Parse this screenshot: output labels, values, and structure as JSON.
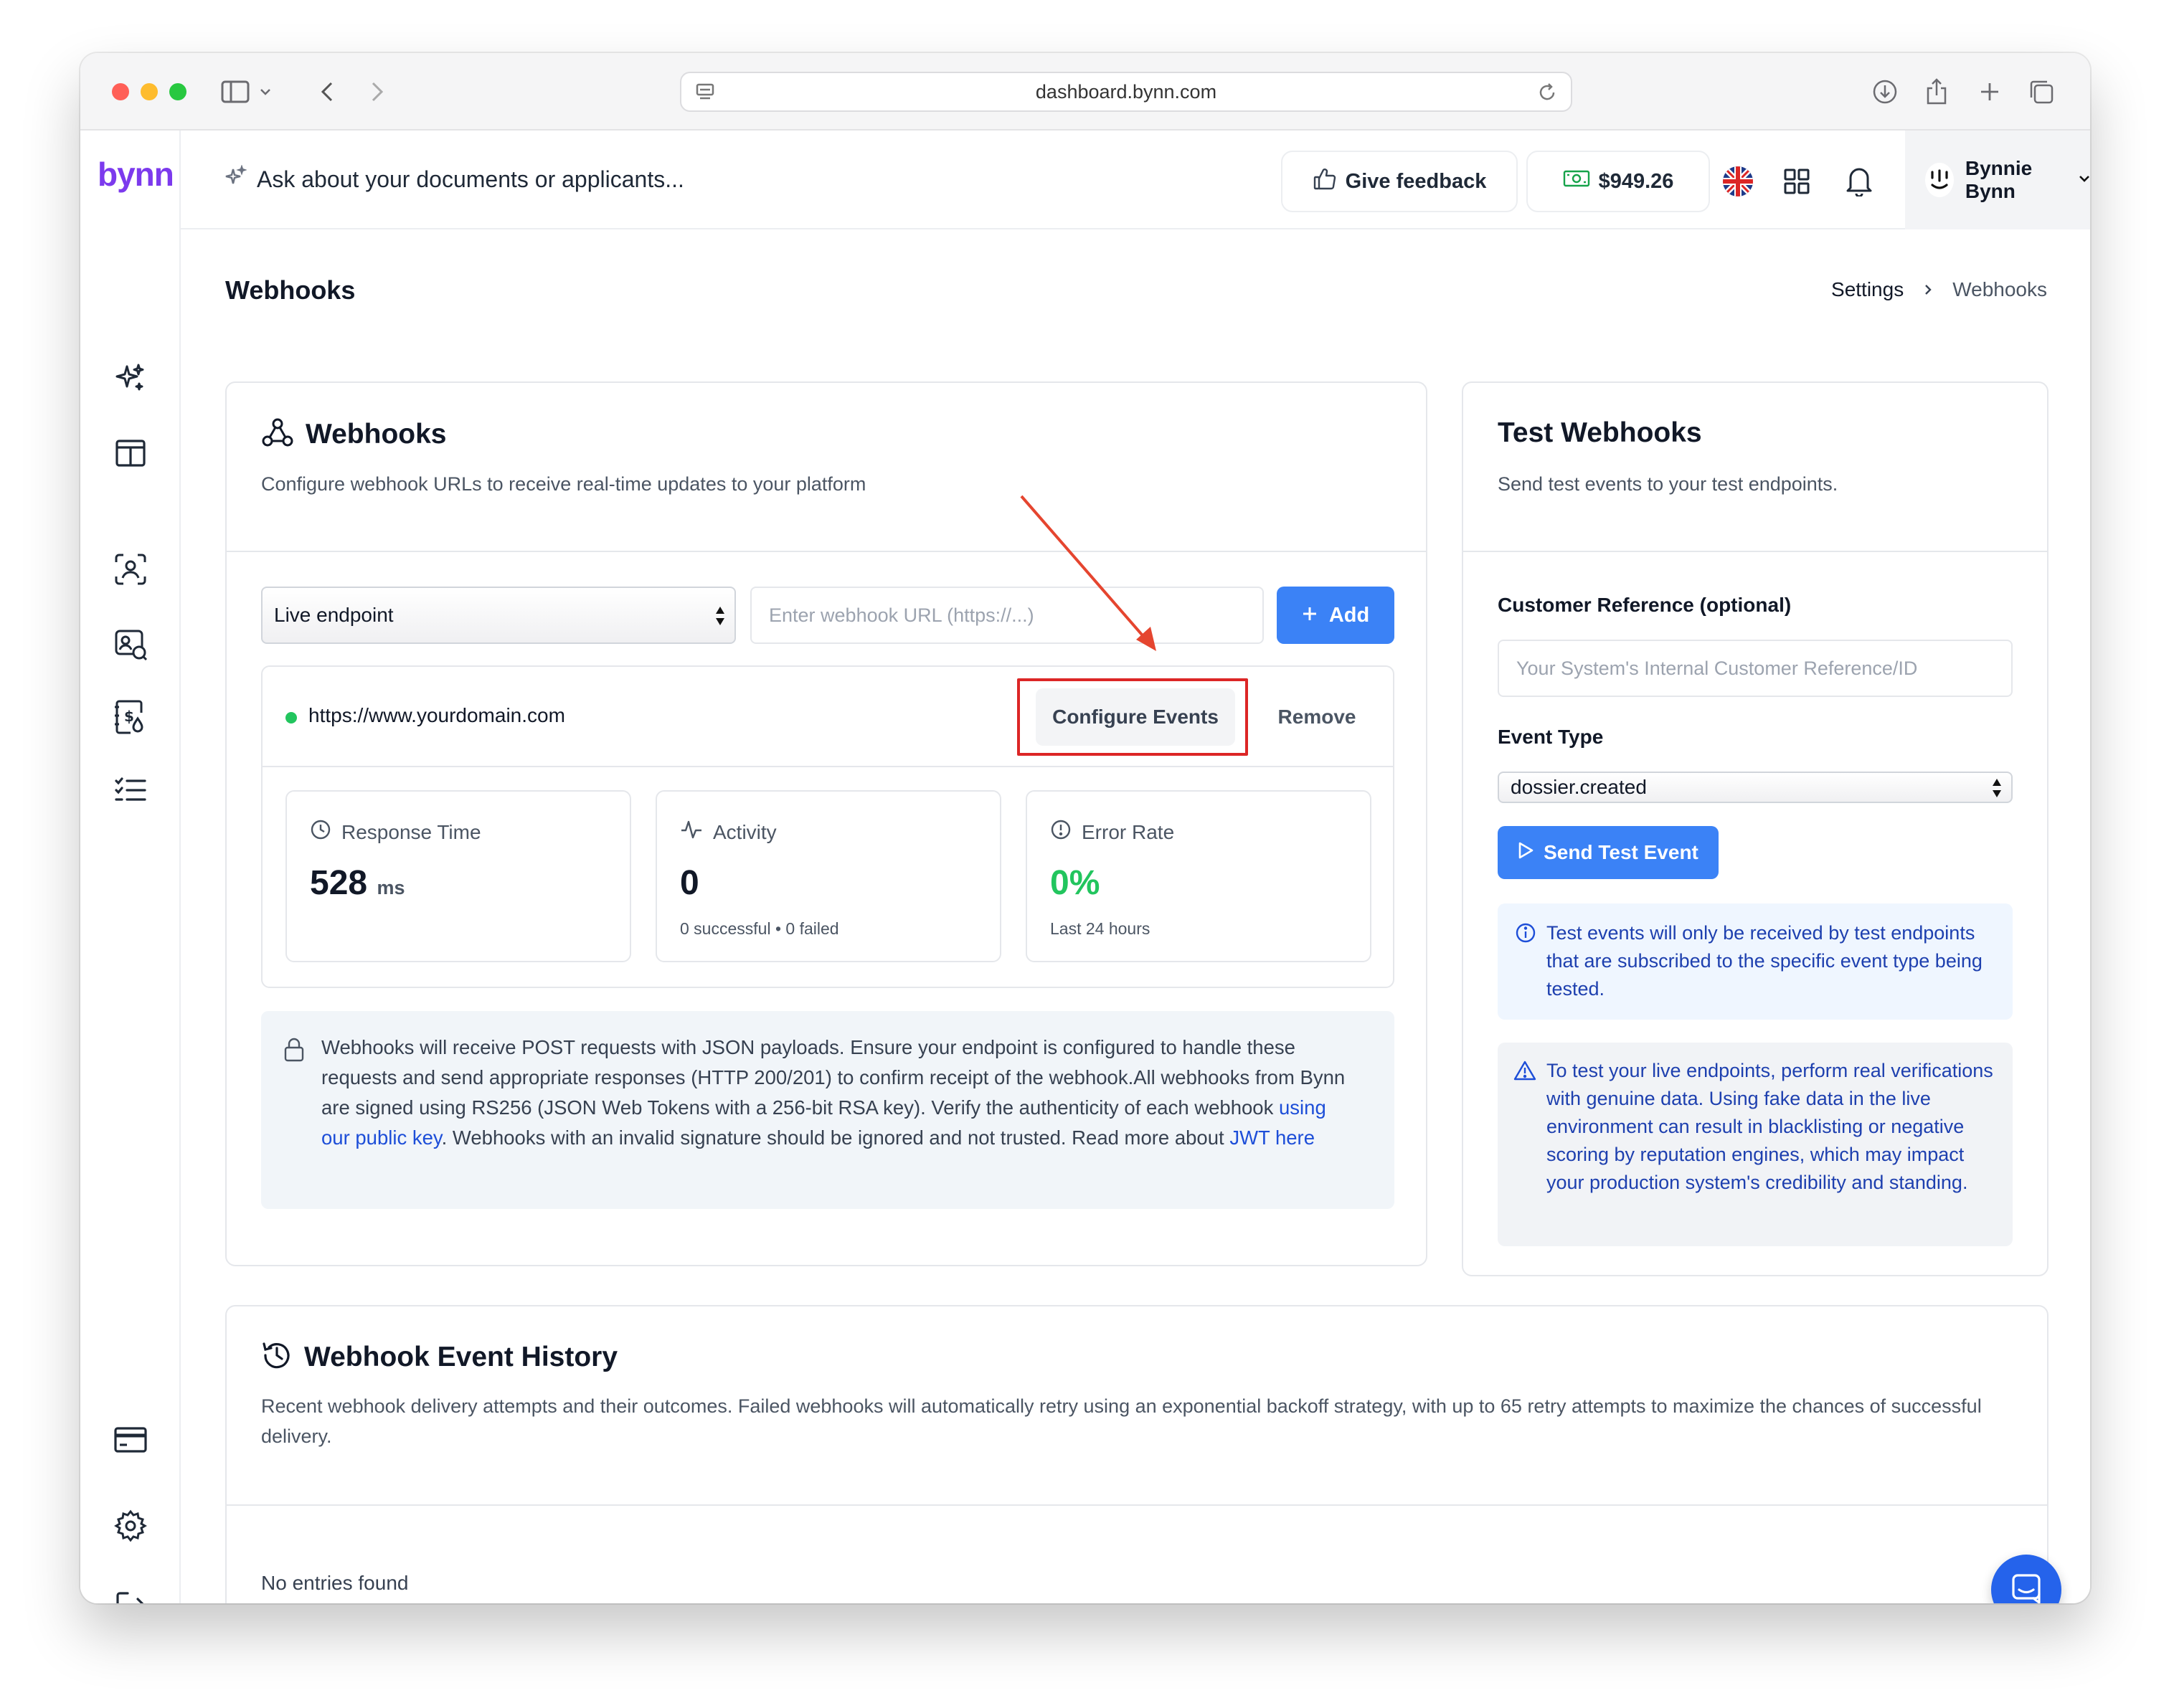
{
  "browser": {
    "url": "dashboard.bynn.com"
  },
  "topbar": {
    "logo": "bynn",
    "search_placeholder": "Ask about your documents or applicants...",
    "feedback_label": "Give feedback",
    "balance": "$949.26",
    "user_name": "Bynnie Bynn"
  },
  "page": {
    "title": "Webhooks",
    "breadcrumb": [
      "Settings",
      "Webhooks"
    ]
  },
  "webhooks": {
    "title": "Webhooks",
    "subtitle": "Configure webhook URLs to receive real-time updates to your platform",
    "endpoint_type": "Live endpoint",
    "url_placeholder": "Enter webhook URL (https://...)",
    "add_label": "Add",
    "endpoint": {
      "url": "https://www.yourdomain.com",
      "status_color": "#22c55e",
      "configure_label": "Configure Events",
      "remove_label": "Remove"
    },
    "stats": {
      "response_time": {
        "label": "Response Time",
        "value": "528",
        "unit": "ms"
      },
      "activity": {
        "label": "Activity",
        "value": "0",
        "note": "0 successful • 0 failed"
      },
      "error_rate": {
        "label": "Error Rate",
        "value": "0%",
        "note": "Last 24 hours"
      }
    },
    "info": {
      "text_1": "Webhooks will receive POST requests with JSON payloads. Ensure your endpoint is configured to handle these requests and send appropriate responses (HTTP 200/201) to confirm receipt of the webhook.All webhooks from Bynn are signed using RS256 (JSON Web Tokens with a 256-bit RSA key). Verify the authenticity of each webhook ",
      "link_1": "using our public key",
      "text_2": ". Webhooks with an invalid signature should be ignored and not trusted. Read more about ",
      "link_2": "JWT here"
    }
  },
  "test": {
    "title": "Test Webhooks",
    "subtitle": "Send test events to your test endpoints.",
    "customer_ref_label": "Customer Reference (optional)",
    "customer_ref_placeholder": "Your System's Internal Customer Reference/ID",
    "event_type_label": "Event Type",
    "event_type_value": "dossier.created",
    "send_label": "Send Test Event",
    "info_note": "Test events will only be received by test endpoints that are subscribed to the specific event type being tested.",
    "warning_note": "To test your live endpoints, perform real verifications with genuine data. Using fake data in the live environment can result in blacklisting or negative scoring by reputation engines, which may impact your production system's credibility and standing."
  },
  "history": {
    "title": "Webhook Event History",
    "subtitle": "Recent webhook delivery attempts and their outcomes. Failed webhooks will automatically retry using an exponential backoff strategy, with up to 65 retry attempts to maximize the chances of successful delivery.",
    "empty": "No entries found"
  },
  "colors": {
    "primary": "#3b82f6",
    "highlight": "#dc2626",
    "success": "#22c55e",
    "brand": "#7c3aed"
  }
}
